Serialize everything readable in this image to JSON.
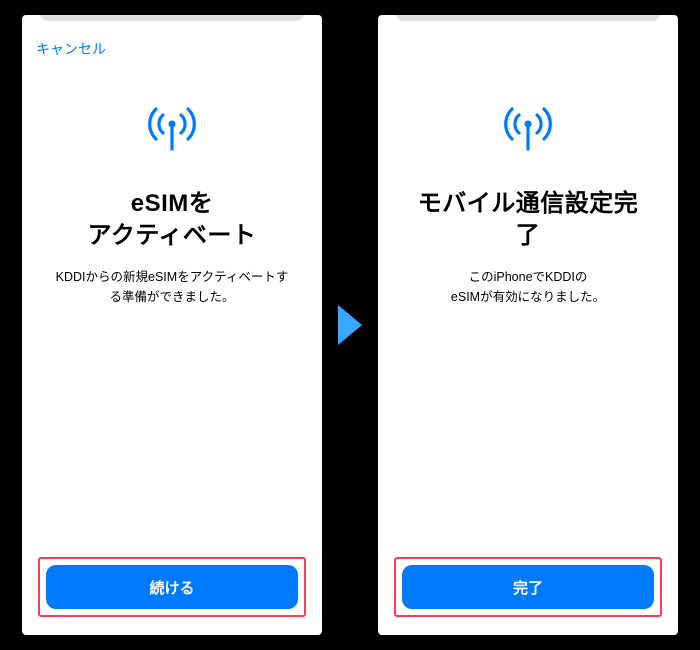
{
  "screen1": {
    "nav": {
      "cancel": "キャンセル"
    },
    "title": "eSIMを\nアクティベート",
    "subtitle": "KDDIからの新規eSIMをアクティベートする準備ができました。",
    "button": "続ける"
  },
  "screen2": {
    "title": "モバイル通信設定完了",
    "subtitle": "このiPhoneでKDDIの\neSIMが有効になりました。",
    "button": "完了"
  },
  "colors": {
    "accent": "#007aff",
    "highlight_border": "#ff3b5c"
  }
}
